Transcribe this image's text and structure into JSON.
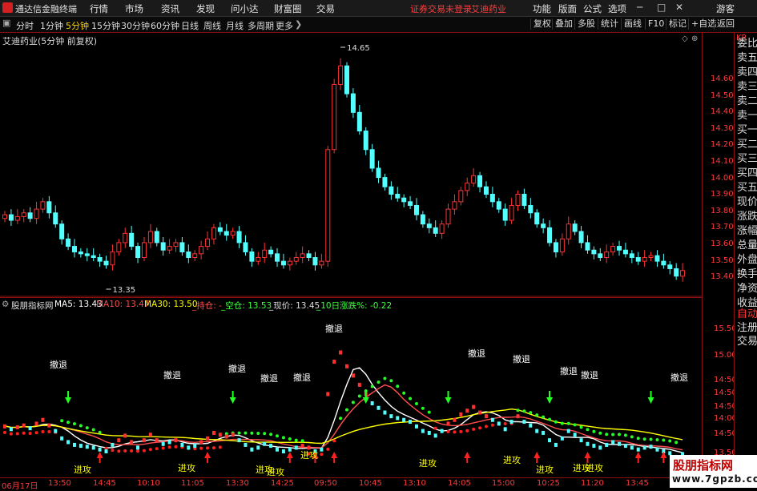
{
  "app": {
    "name": "通达信金融终端"
  },
  "menu": [
    "行情",
    "市场",
    "资讯",
    "发现",
    "问小达",
    "财富圈",
    "交易"
  ],
  "alert": {
    "login": "证券交易未登录",
    "stock": "艾迪药业"
  },
  "top_right": [
    "功能",
    "版面",
    "公式",
    "选项",
    "游客"
  ],
  "periods": [
    {
      "label": "分时",
      "active": false
    },
    {
      "label": "1分钟",
      "active": false
    },
    {
      "label": "5分钟",
      "active": true
    },
    {
      "label": "15分钟",
      "active": false
    },
    {
      "label": "30分钟",
      "active": false
    },
    {
      "label": "60分钟",
      "active": false
    },
    {
      "label": "日线",
      "active": false
    },
    {
      "label": "周线",
      "active": false
    },
    {
      "label": "月线",
      "active": false
    },
    {
      "label": "多周期",
      "active": false
    },
    {
      "label": "更多",
      "active": false
    }
  ],
  "tool_buttons": [
    "复权",
    "叠加",
    "多股",
    "统计",
    "画线",
    "F10",
    "标记",
    "+自选",
    "返回"
  ],
  "chart_title": "艾迪药业(5分钟 前复权)",
  "price_axis": [
    "14.60",
    "14.50",
    "14.40",
    "14.30",
    "14.20",
    "14.10",
    "14.00",
    "13.90",
    "13.80",
    "13.70",
    "13.60",
    "13.50",
    "13.40"
  ],
  "high_label": "14.65",
  "low_label": "13.35",
  "indicator": {
    "name": "股朋指标网",
    "ma5": "MA5: 13.43",
    "ma10": "MA10: 13.47",
    "ma30": "MA30: 13.50",
    "hold": "_持仓: -",
    "empty": "_空仓: 13.53",
    "now": "_现价: 13.45",
    "chg": "_10日涨跌%: -0.22"
  },
  "ind_axis": [
    "15.50",
    "15.00",
    "14:50",
    "14:50",
    "14:50",
    "14:00",
    "14:50",
    "13.50",
    "14:50"
  ],
  "signals": {
    "attack": "进攻",
    "retreat": "撤退"
  },
  "time_axis": [
    "06月17日",
    "13:50",
    "14:45",
    "10:10",
    "11:05",
    "13:30",
    "14:25",
    "09:50",
    "10:45",
    "13:10",
    "14:05",
    "15:00",
    "10:25",
    "11:20",
    "13:45"
  ],
  "right_panel": [
    {
      "label": "委比",
      "hl": false
    },
    {
      "label": "卖五",
      "hl": false
    },
    {
      "label": "卖四",
      "hl": false
    },
    {
      "label": "卖三",
      "hl": false
    },
    {
      "label": "卖二",
      "hl": false
    },
    {
      "label": "卖一",
      "hl": false
    },
    {
      "label": "买一",
      "hl": false
    },
    {
      "label": "买二",
      "hl": false
    },
    {
      "label": "买三",
      "hl": false
    },
    {
      "label": "买四",
      "hl": false
    },
    {
      "label": "买五",
      "hl": false
    },
    {
      "label": "现价",
      "hl": false
    },
    {
      "label": "涨跌",
      "hl": false
    },
    {
      "label": "涨幅",
      "hl": false
    },
    {
      "label": "总量",
      "hl": false
    },
    {
      "label": "外盘",
      "hl": false
    },
    {
      "label": "换手",
      "hl": false
    },
    {
      "label": "净资",
      "hl": false
    },
    {
      "label": "收益",
      "hl": false
    },
    {
      "label": "自动",
      "hl": true
    },
    {
      "label": "注册",
      "hl": false
    },
    {
      "label": "交易",
      "hl": false
    }
  ],
  "watermark": {
    "line1": "股朋指标网",
    "line2": "www.7gpzb.com"
  },
  "colors": {
    "up": "#ff3232",
    "down": "#54ffff",
    "ma5": "#ffffff",
    "ma10": "#ff4d4d",
    "ma30": "#ffff00",
    "grid": "#8a1010"
  },
  "chart_data": [
    {
      "type": "candlestick",
      "title": "艾迪药业(5分钟 前复权)",
      "ylim": [
        13.35,
        14.65
      ],
      "close": [
        13.75,
        13.72,
        13.74,
        13.76,
        13.73,
        13.78,
        13.82,
        13.76,
        13.7,
        13.62,
        13.58,
        13.55,
        13.54,
        13.53,
        13.52,
        13.5,
        13.48,
        13.55,
        13.6,
        13.65,
        13.58,
        13.52,
        13.6,
        13.66,
        13.6,
        13.56,
        13.58,
        13.6,
        13.55,
        13.52,
        13.54,
        13.58,
        13.62,
        13.68,
        13.66,
        13.64,
        13.66,
        13.6,
        13.55,
        13.5,
        13.52,
        13.56,
        13.54,
        13.5,
        13.48,
        13.5,
        13.52,
        13.54,
        13.52,
        13.48,
        13.5,
        14.1,
        14.45,
        14.55,
        14.4,
        14.3,
        14.2,
        14.1,
        14.0,
        13.95,
        13.9,
        13.86,
        13.84,
        13.82,
        13.8,
        13.75,
        13.7,
        13.68,
        13.65,
        13.7,
        13.78,
        13.82,
        13.88,
        13.92,
        13.96,
        13.9,
        13.86,
        13.82,
        13.78,
        13.72,
        13.8,
        13.86,
        13.8,
        13.76,
        13.7,
        13.68,
        13.6,
        13.55,
        13.62,
        13.7,
        13.66,
        13.6,
        13.56,
        13.54,
        13.52,
        13.55,
        13.58,
        13.56,
        13.54,
        13.52,
        13.5,
        13.52,
        13.53,
        13.5,
        13.48,
        13.46,
        13.42,
        13.45
      ],
      "high_label": 14.65,
      "low_label": 13.35
    },
    {
      "type": "line",
      "title": "股朋指标网",
      "series": [
        {
          "name": "MA5",
          "last": 13.43
        },
        {
          "name": "MA10",
          "last": 13.47
        },
        {
          "name": "MA30",
          "last": 13.5
        }
      ]
    }
  ]
}
